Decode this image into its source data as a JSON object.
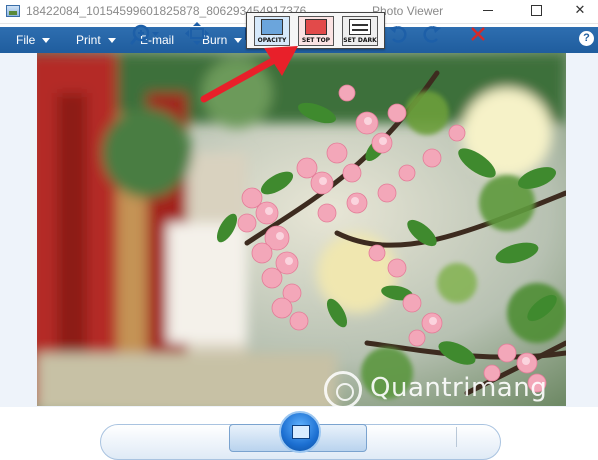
{
  "window": {
    "title": "18422084_10154599601825878_806293454917376...",
    "app_name": "Photo Viewer",
    "controls": {
      "minimize": "minimize",
      "maximize": "maximize",
      "close": "✕"
    }
  },
  "overlay_toolbar": {
    "buttons": [
      {
        "label": "OPACITY",
        "icon": "opacity-icon",
        "color": "#6ba5dc"
      },
      {
        "label": "SET TOP",
        "icon": "set-top-icon",
        "color": "#e24a4a"
      },
      {
        "label": "SET DARK",
        "icon": "set-dark-icon",
        "color": "#ffffff"
      }
    ]
  },
  "menu": {
    "items": [
      {
        "label": "File",
        "has_dropdown": true
      },
      {
        "label": "Print",
        "has_dropdown": true
      },
      {
        "label": "E-mail",
        "has_dropdown": false
      },
      {
        "label": "Burn",
        "has_dropdown": true
      }
    ],
    "help": "?"
  },
  "photo": {
    "subject": "cherry-blossom"
  },
  "watermark": {
    "text": "Quantrimang"
  },
  "bottom_toolbar": {
    "buttons": [
      "zoom-icon",
      "fit-window-icon",
      "previous-icon",
      "slideshow-icon",
      "next-icon",
      "rotate-left-icon",
      "rotate-right-icon",
      "delete-icon"
    ]
  },
  "colors": {
    "menubar": "#1f5d9e",
    "arrow": "#e8202a",
    "delete": "#d42a2a"
  }
}
